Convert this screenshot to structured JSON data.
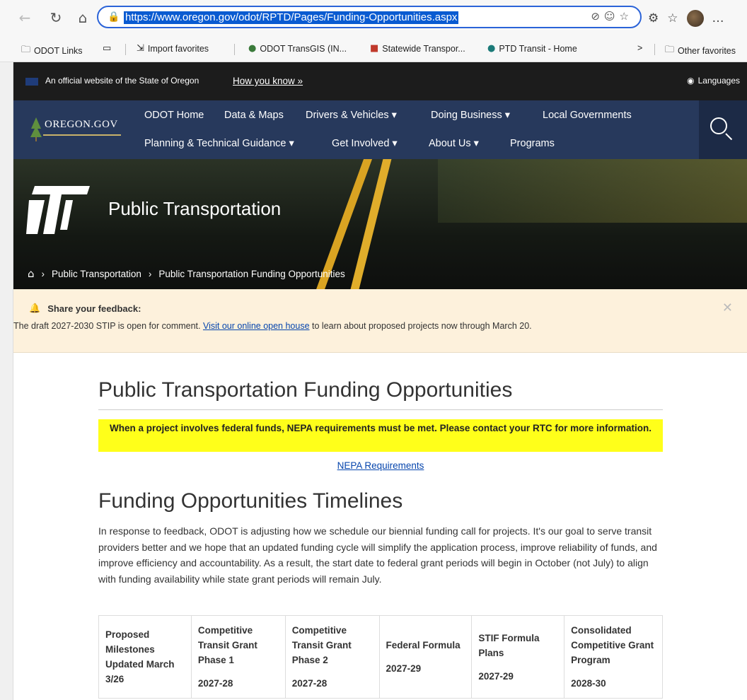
{
  "browser": {
    "url": "https://www.oregon.gov/odot/RPTD/Pages/Funding-Opportunities.aspx",
    "favorites": [
      {
        "label": "ODOT Links",
        "icon": "folder-lock-icon"
      },
      {
        "label": "",
        "icon": "reading-icon"
      },
      {
        "label": "Import favorites",
        "icon": "import-icon"
      },
      {
        "label": "ODOT TransGIS (IN...",
        "icon": "globe-icon"
      },
      {
        "label": "Statewide Transpor...",
        "icon": "pdf-icon"
      },
      {
        "label": "PTD Transit - Home",
        "icon": "sharepoint-icon"
      }
    ],
    "other_favorites": "Other favorites",
    "more_chevron": ">"
  },
  "official_bar": {
    "text": "An official website of the State of Oregon",
    "how_you_know": "How you know »",
    "languages": "Languages"
  },
  "nav": {
    "logo": "OREGON.GOV",
    "row1": [
      {
        "label": "ODOT Home"
      },
      {
        "label": "Data & Maps"
      },
      {
        "label": "Drivers & Vehicles ▾"
      },
      {
        "label": "Doing Business ▾"
      },
      {
        "label": "Local Governments"
      }
    ],
    "row2": [
      {
        "label": "Planning & Technical Guidance ▾"
      },
      {
        "label": "Get Involved ▾"
      },
      {
        "label": "About Us ▾"
      },
      {
        "label": "Programs"
      }
    ]
  },
  "hero": {
    "title": "Public Transportation",
    "breadcrumbs": [
      "Public Transportation",
      "Public Transportation Funding Opportunities"
    ]
  },
  "feedback": {
    "heading": "Share your feedback:",
    "before": "The draft 2027-2030 STIP is open for comment. ",
    "link": "Visit our online open house",
    "after": " to learn about  proposed projects now through March 20."
  },
  "content": {
    "title": "Public Transportation Funding Opportunities",
    "notice": "When a project involves federal funds, NEPA requirements must be met. Please contact your RTC for more information.",
    "nepa_link": "NEPA Requirements",
    "timelines_title": "Funding Opportunities Timelines",
    "intro": "In response to feedback, ODOT is adjusting how we schedule our biennial funding call for projects. It's our goal to serve transit providers better and we hope that an updated funding cycle will simplify the application process, improve reliability of funds, and improve efficiency and accountability. As a result, the start date to federal grant periods will begin in October (not July) to align with funding availability while state grant periods will remain July.",
    "table_headers": [
      {
        "name": "Proposed Milestones Updated March 3/26",
        "years": ""
      },
      {
        "name": "Competitive Transit Grant Phase 1",
        "years": "2027-28"
      },
      {
        "name": "Competitive Transit Grant Phase 2",
        "years": "2027-28"
      },
      {
        "name": "Federal Formula",
        "years": "2027-29"
      },
      {
        "name": "STIF Formula Plans",
        "years": "2027-29"
      },
      {
        "name": "Consolidated Competitive Grant Program",
        "years": "2028-30"
      }
    ]
  }
}
